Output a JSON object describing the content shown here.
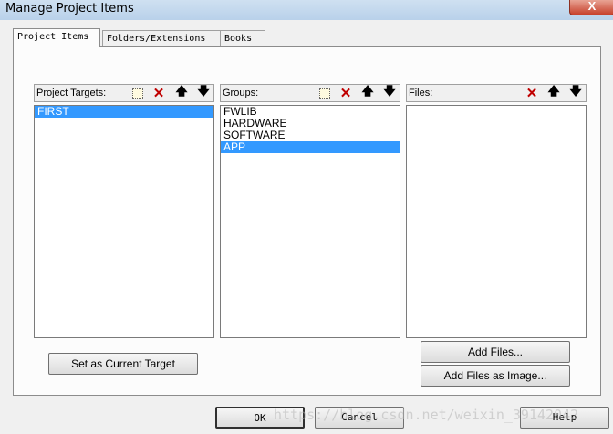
{
  "window": {
    "title": "Manage Project Items",
    "close_glyph": "X"
  },
  "tabs": [
    {
      "label": "Project Items",
      "active": true
    },
    {
      "label": "Folders/Extensions",
      "active": false
    },
    {
      "label": "Books",
      "active": false
    }
  ],
  "panels": {
    "targets": {
      "label": "Project Targets:",
      "items": [
        "FIRST"
      ],
      "selected_index": 0
    },
    "groups": {
      "label": "Groups:",
      "items": [
        "FWLIB",
        "HARDWARE",
        "SOFTWARE",
        "APP"
      ],
      "selected_index": 3
    },
    "files": {
      "label": "Files:",
      "items": []
    }
  },
  "toolbar_icons": {
    "new": "new-icon",
    "delete": "delete-icon",
    "up": "move-up-icon",
    "down": "move-down-icon"
  },
  "buttons": {
    "set_current_target": "Set as Current Target",
    "add_files": "Add Files...",
    "add_files_image": "Add Files as Image...",
    "ok": "OK",
    "cancel": "Cancel",
    "help": "Help"
  },
  "watermark": "https://blog.csdn.net/weixin_39142042"
}
